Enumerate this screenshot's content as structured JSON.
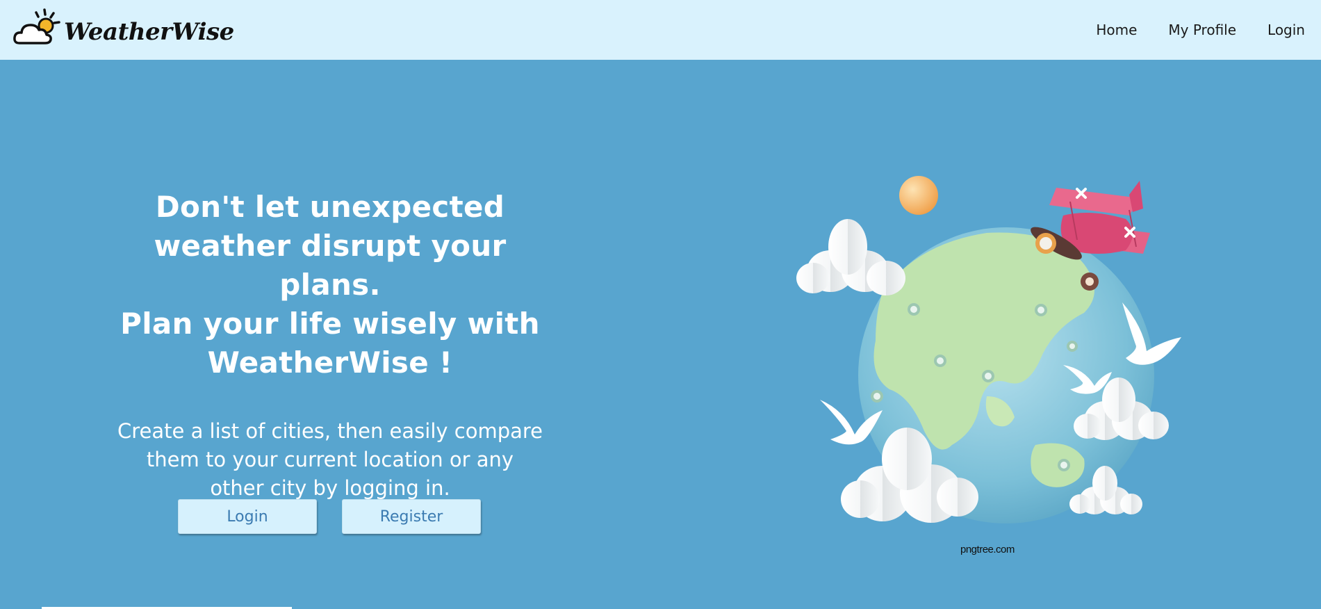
{
  "brand": {
    "name": "WeatherWise",
    "logo_icon": "cloud-sun-icon"
  },
  "nav": {
    "items": [
      {
        "label": "Home"
      },
      {
        "label": "My Profile"
      },
      {
        "label": "Login"
      }
    ]
  },
  "hero": {
    "title_lines": [
      "Don't let unexpected",
      "weather disrupt your plans.",
      "Plan your life wisely with",
      "WeatherWise !"
    ],
    "subtitle_lines": [
      "Create a list of cities, then easily compare",
      "them to your current location or any",
      "other city by logging in."
    ],
    "login_label": "Login",
    "register_label": "Register"
  },
  "illustration": {
    "credit": "pngtree.com"
  },
  "colors": {
    "navbar_bg": "#d9f2fd",
    "page_bg": "#58a5cf",
    "button_bg": "#d6f1fd",
    "button_text": "#3b7bb1"
  }
}
